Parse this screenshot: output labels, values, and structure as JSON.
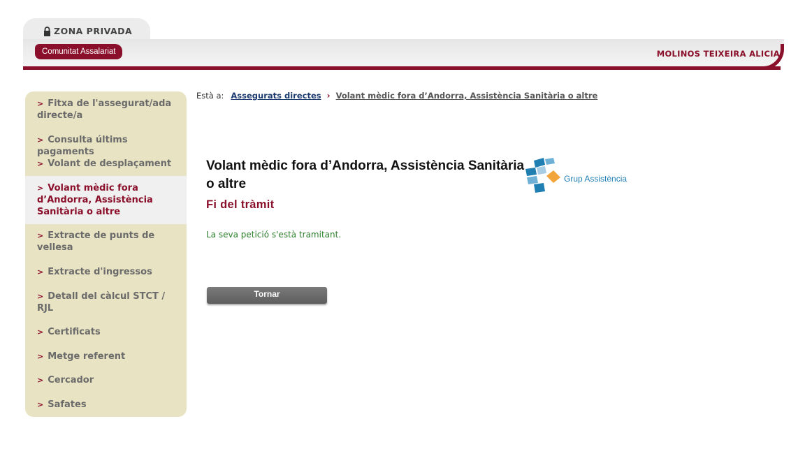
{
  "header": {
    "zona_label": "ZONA PRIVADA",
    "community_tab": "Comunitat Assalariat",
    "user_name": "MOLINOS TEIXEIRA ALICIA"
  },
  "sidebar": {
    "items": [
      {
        "label": "Fitxa de l'assegurat/ada directe/a"
      },
      {
        "label": "Consulta últims pagaments"
      },
      {
        "label": "Volant de desplaçament"
      },
      {
        "label": "Volant mèdic fora d’Andorra, Assistència Sanitària o altre"
      },
      {
        "label": "Extracte de punts de vellesa"
      },
      {
        "label": "Extracte d'ingressos"
      },
      {
        "label": "Detall del càlcul STCT / RJL"
      },
      {
        "label": "Certificats"
      },
      {
        "label": "Metge referent"
      },
      {
        "label": "Cercador"
      },
      {
        "label": "Safates"
      }
    ]
  },
  "breadcrumb": {
    "prefix": "Està a:",
    "parent": "Assegurats directes",
    "current": "Volant mèdic fora d’Andorra, Assistència Sanitària o altre"
  },
  "main": {
    "title": "Volant mèdic fora d’Andorra, Assistència Sanitària o altre",
    "subtitle": "Fi del tràmit",
    "message": "La seva petició s'està tramitant.",
    "return_button": "Tornar",
    "logo_text": "Grup Assistència"
  },
  "colors": {
    "brand": "#8a0f2b",
    "sidebar_bg": "#e8e3c2",
    "message": "#2f7d2f",
    "link": "#1b3b6f"
  }
}
